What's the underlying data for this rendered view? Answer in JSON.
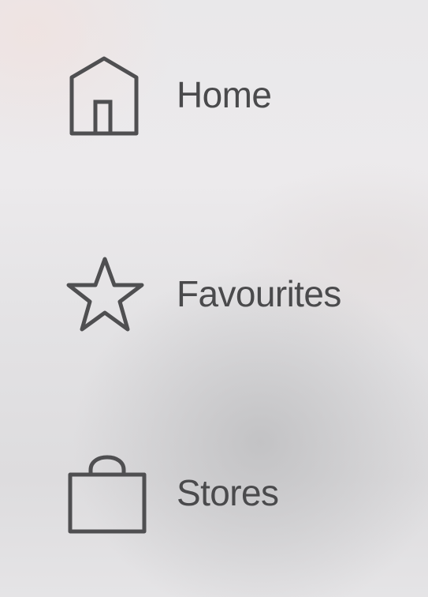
{
  "menu": {
    "items": [
      {
        "label": "Home",
        "icon": "home-icon"
      },
      {
        "label": "Favourites",
        "icon": "star-icon"
      },
      {
        "label": "Stores",
        "icon": "shopping-bag-icon"
      }
    ]
  },
  "colors": {
    "text": "#4a4a4c",
    "icon_stroke": "#4f4f51"
  }
}
